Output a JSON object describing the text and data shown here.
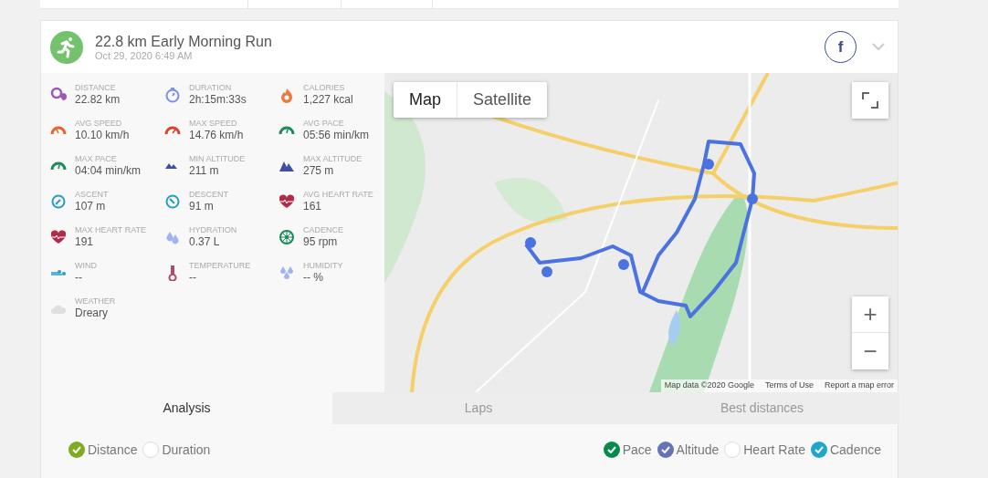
{
  "activity": {
    "title": "22.8 km Early Morning Run",
    "date": "Oct 29, 2020 6:49 AM",
    "share_label": "f"
  },
  "stats": [
    {
      "kind": "distance",
      "label": "DISTANCE",
      "value": "22.82 km"
    },
    {
      "kind": "duration",
      "label": "DURATION",
      "value": "2h:15m:33s"
    },
    {
      "kind": "calories",
      "label": "CALORIES",
      "value": "1,227 kcal"
    },
    {
      "kind": "avg-speed",
      "label": "AVG SPEED",
      "value": "10.10 km/h"
    },
    {
      "kind": "max-speed",
      "label": "MAX SPEED",
      "value": "14.76 km/h"
    },
    {
      "kind": "pace",
      "label": "AVG PACE",
      "value": "05:56 min/km"
    },
    {
      "kind": "pace",
      "label": "MAX PACE",
      "value": "04:04 min/km"
    },
    {
      "kind": "min-altitude",
      "label": "MIN ALTITUDE",
      "value": "211 m"
    },
    {
      "kind": "max-altitude",
      "label": "MAX ALTITUDE",
      "value": "275 m"
    },
    {
      "kind": "ascent",
      "label": "ASCENT",
      "value": "107 m"
    },
    {
      "kind": "descent",
      "label": "DESCENT",
      "value": "91 m"
    },
    {
      "kind": "heart",
      "label": "AVG HEART RATE",
      "value": "161"
    },
    {
      "kind": "heart",
      "label": "MAX HEART RATE",
      "value": "191"
    },
    {
      "kind": "hydration",
      "label": "HYDRATION",
      "value": "0.37 L"
    },
    {
      "kind": "cadence",
      "label": "CADENCE",
      "value": "95 rpm"
    },
    {
      "kind": "wind",
      "label": "WIND",
      "value": "--"
    },
    {
      "kind": "temperature",
      "label": "TEMPERATURE",
      "value": "--"
    },
    {
      "kind": "humidity",
      "label": "HUMIDITY",
      "value": "-- %"
    },
    {
      "kind": "weather",
      "label": "WEATHER",
      "value": "Dreary"
    }
  ],
  "map": {
    "map_types": [
      {
        "label": "Map",
        "selected": true
      },
      {
        "label": "Satellite",
        "selected": false
      }
    ],
    "zoom_in": "+",
    "zoom_out": "−",
    "attribution": [
      "Map data ©2020 Google",
      "Terms of Use",
      "Report a map error"
    ]
  },
  "tabs": [
    {
      "label": "Analysis",
      "selected": true
    },
    {
      "label": "Laps",
      "selected": false
    },
    {
      "label": "Best distances",
      "selected": false
    }
  ],
  "series_left": [
    {
      "label": "Distance",
      "checked": true,
      "color": "#7fab1f"
    },
    {
      "label": "Duration",
      "checked": false
    }
  ],
  "series_right": [
    {
      "label": "Pace",
      "checked": true,
      "color": "#0a8a4a"
    },
    {
      "label": "Altitude",
      "checked": true,
      "color": "#6673b6"
    },
    {
      "label": "Heart Rate",
      "checked": false
    },
    {
      "label": "Cadence",
      "checked": true,
      "color": "#1fa6cf"
    }
  ]
}
